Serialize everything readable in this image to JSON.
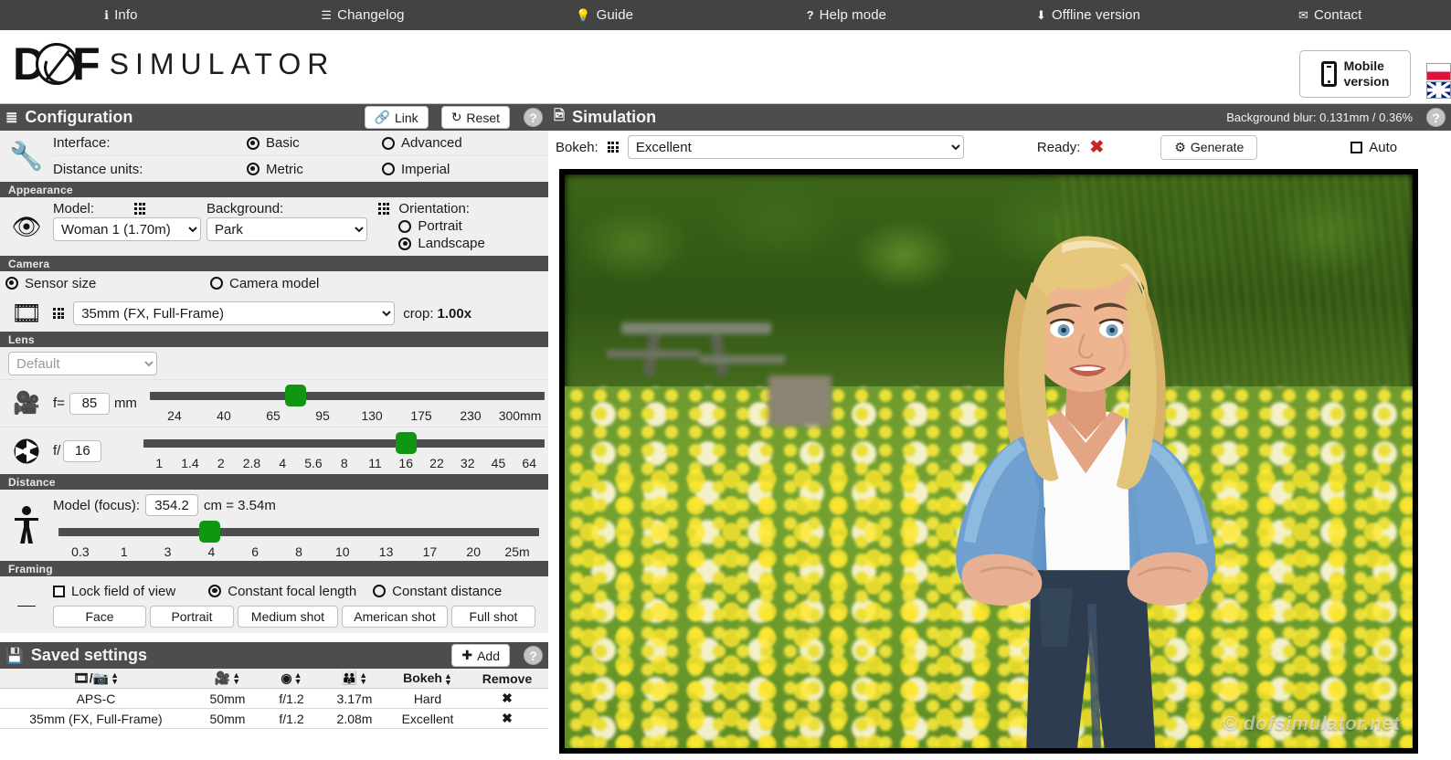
{
  "topnav": {
    "items": [
      {
        "icon": "info-icon",
        "glyph": "ℹ",
        "label": "Info"
      },
      {
        "icon": "list-icon",
        "glyph": "☰",
        "label": "Changelog"
      },
      {
        "icon": "bulb-icon",
        "glyph": "Ὂ1",
        "label": "Guide"
      },
      {
        "icon": "question-icon",
        "glyph": "?",
        "label": "Help mode"
      },
      {
        "icon": "download-icon",
        "glyph": "⬇",
        "label": "Offline version"
      },
      {
        "icon": "mail-icon",
        "glyph": "✉",
        "label": "Contact"
      }
    ]
  },
  "brand": {
    "logo_dof": "D",
    "logo_dof_f": "F",
    "logo_word": "SIMULATOR",
    "mobile_line1": "Mobile",
    "mobile_line2": "version",
    "flag_pl": "polish-flag",
    "flag_en": "uk-flag"
  },
  "configuration": {
    "title": "Configuration",
    "link_label": "Link",
    "reset_label": "Reset",
    "help_label": "?",
    "interface_label": "Interface:",
    "interface_options": [
      "Basic",
      "Advanced"
    ],
    "interface_selected": "Basic",
    "units_label": "Distance units:",
    "units_options": [
      "Metric",
      "Imperial"
    ],
    "units_selected": "Metric"
  },
  "appearance": {
    "title": "Appearance",
    "model_label": "Model:",
    "model_value": "Woman 1 (1.70m)",
    "background_label": "Background:",
    "background_value": "Park",
    "orientation_label": "Orientation:",
    "orientation_options": [
      "Portrait",
      "Landscape"
    ],
    "orientation_selected": "Landscape"
  },
  "camera": {
    "title": "Camera",
    "mode_options": [
      "Sensor size",
      "Camera model"
    ],
    "mode_selected": "Sensor size",
    "sensor_value": "35mm (FX, Full-Frame)",
    "crop_label": "crop:",
    "crop_value": "1.00x"
  },
  "lens": {
    "title": "Lens",
    "lens_select_value": "Default",
    "focal_prefix": "f=",
    "focal_value": "85",
    "focal_unit": "mm",
    "focal_ticks": [
      "24",
      "40",
      "65",
      "95",
      "130",
      "175",
      "230",
      "300mm"
    ],
    "focal_knob_pct": 37.0,
    "aperture_prefix": "f/",
    "aperture_value": "16",
    "aperture_ticks": [
      "1",
      "1.4",
      "2",
      "2.8",
      "4",
      "5.6",
      "8",
      "11",
      "16",
      "22",
      "32",
      "45",
      "64"
    ],
    "aperture_knob_pct": 65.5
  },
  "distance": {
    "title": "Distance",
    "focus_label": "Model (focus):",
    "focus_value": "354.2",
    "focus_suffix": "cm = 3.54m",
    "ticks": [
      "0.3",
      "1",
      "3",
      "4",
      "6",
      "8",
      "10",
      "13",
      "17",
      "20",
      "25m"
    ],
    "knob_pct": 31.5
  },
  "framing": {
    "title": "Framing",
    "lock_label": "Lock field of view",
    "lock_checked": false,
    "mode_options": [
      "Constant focal length",
      "Constant distance"
    ],
    "mode_selected": "Constant focal length",
    "shot_buttons": [
      "Face",
      "Portrait",
      "Medium shot",
      "American shot",
      "Full shot"
    ]
  },
  "saved_settings": {
    "title": "Saved settings",
    "add_label": "Add",
    "help_label": "?",
    "columns": [
      "sensor-camera",
      "focal-length",
      "aperture",
      "distance",
      "Bokeh",
      "Remove"
    ],
    "bokeh_header": "Bokeh",
    "remove_header": "Remove",
    "rows": [
      {
        "sensor": "APS-C",
        "focal": "50mm",
        "aperture": "f/1.2",
        "distance": "3.17m",
        "bokeh": "Hard",
        "remove": "✖"
      },
      {
        "sensor": "35mm (FX, Full-Frame)",
        "focal": "50mm",
        "aperture": "f/1.2",
        "distance": "2.08m",
        "bokeh": "Excellent",
        "remove": "✖"
      }
    ]
  },
  "simulation": {
    "title": "Simulation",
    "blur_info": "Background blur: 0.131mm / 0.36%",
    "help_label": "?",
    "bokeh_label": "Bokeh:",
    "bokeh_value": "Excellent",
    "ready_label": "Ready:",
    "ready_mark": "✖",
    "generate_label": "Generate",
    "auto_label": "Auto",
    "auto_checked": false,
    "watermark": "© dofsimulator.net",
    "scene": {
      "background_name": "Park",
      "model_name": "Woman 1"
    }
  },
  "colors": {
    "nav_bg": "#434343",
    "panel_head_bg": "#4d4d4d",
    "slider_green": "#109610",
    "ready_red": "#cc2222",
    "body_bg": "#efefef"
  }
}
